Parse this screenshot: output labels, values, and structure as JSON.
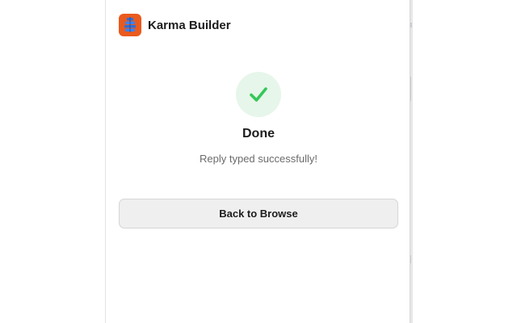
{
  "app": {
    "title": "Karma Builder",
    "logo_icon": "stacked-blocks-icon",
    "logo_color": "#ea5a1e"
  },
  "status": {
    "icon": "checkmark-icon",
    "icon_color": "#34c759",
    "title": "Done",
    "message": "Reply typed successfully!"
  },
  "actions": {
    "back_label": "Back to Browse"
  }
}
